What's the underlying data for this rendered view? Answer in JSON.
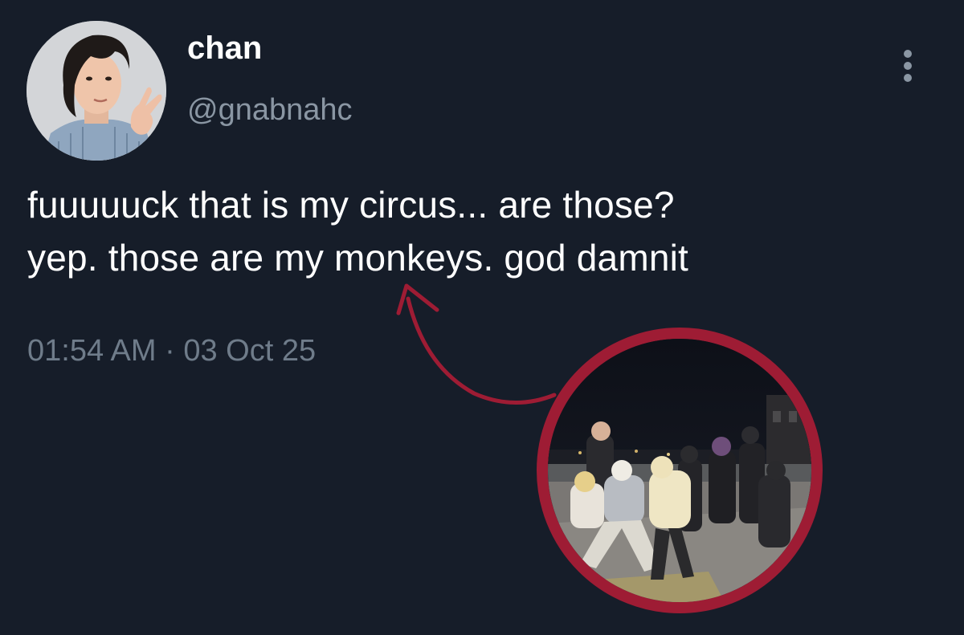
{
  "tweet": {
    "display_name": "chan",
    "handle": "@gnabnahc",
    "text_lines": [
      "fuuuuuck that is my circus... are those?",
      "yep. those are my monkeys. god damnit"
    ],
    "timestamp": "01:54 AM · 03 Oct 25"
  },
  "icons": {
    "more": "more-vertical-icon"
  },
  "colors": {
    "background": "#161d29",
    "text_primary": "#ffffff",
    "text_secondary": "#8a96a3",
    "annotation": "#9e1c34"
  }
}
